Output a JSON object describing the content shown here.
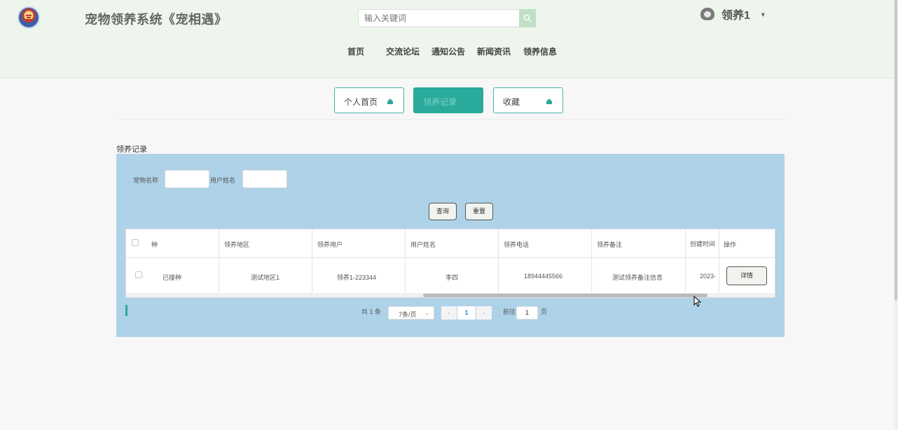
{
  "header": {
    "site_title": "宠物领养系统《宠相遇》",
    "search_placeholder": "输入关键词",
    "user_name": "领养1",
    "caret": "▼"
  },
  "nav": [
    "首页",
    "交流论坛",
    "通知公告",
    "新闻资讯",
    "领养信息"
  ],
  "tabs": [
    {
      "label": "个人首页",
      "active": false
    },
    {
      "label": "领养记录",
      "active": true
    },
    {
      "label": "收藏",
      "active": false
    }
  ],
  "section_title": "领养记录",
  "filters": {
    "pet_name_label": "宠物名称",
    "user_name_label": "用户姓名",
    "query_button": "查询",
    "reset_button": "重置"
  },
  "table": {
    "columns": [
      "种",
      "领养地区",
      "领养用户",
      "用户姓名",
      "领养电话",
      "领养备注",
      "创建时间",
      "操作"
    ],
    "rows": [
      {
        "vaccination": "已接种",
        "region": "测试地区1",
        "adopter": "领养1-223344",
        "user_name": "李四",
        "phone": "18944445566",
        "note": "测试领养备注信息",
        "created": "2023-",
        "action": "详情"
      }
    ]
  },
  "pagination": {
    "total_text": "共 1 条",
    "page_size": "7条/页",
    "prev": "‹",
    "current_page": "1",
    "next": "›",
    "goto_label": "前往",
    "goto_value": "1",
    "page_suffix": "页"
  },
  "colors": {
    "accent": "#2aaa9a",
    "panel_bg": "#aed2e8",
    "header_bg": "#eef5ec"
  }
}
